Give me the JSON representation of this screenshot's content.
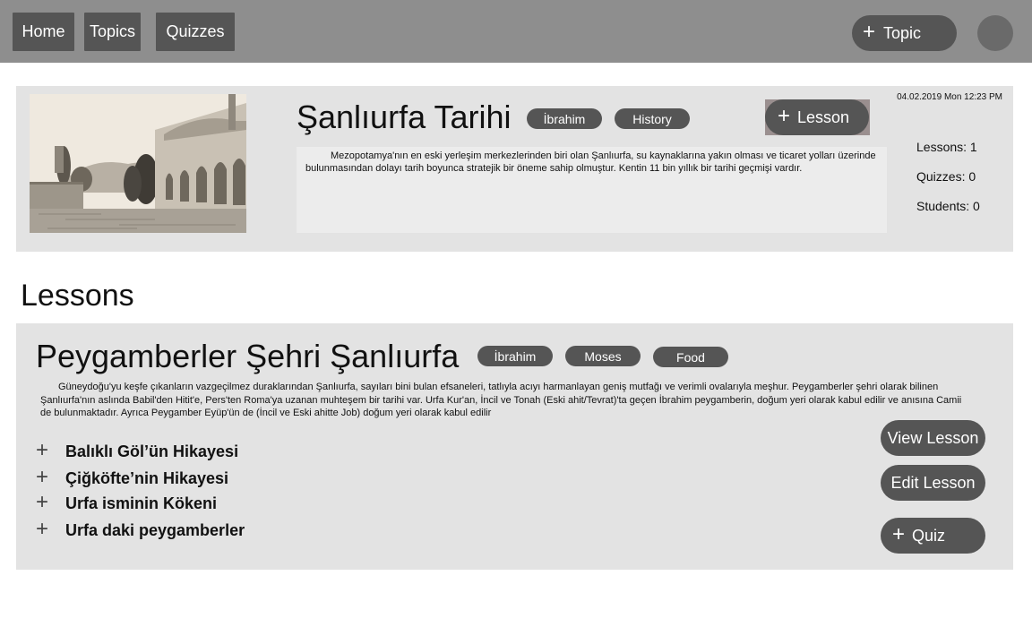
{
  "nav": {
    "home": "Home",
    "topics": "Topics",
    "quizzes": "Quizzes",
    "add_topic_icon": "plus-icon",
    "add_topic": "Topic"
  },
  "topic": {
    "title": "Şanlıurfa Tarihi",
    "tags": [
      "İbrahim",
      "History"
    ],
    "add_lesson": "Lesson",
    "datetime": "04.02.2019 Mon 12:23 PM",
    "description": "Mezopotamya'nın en eski yerleşim merkezlerinden biri olan Şanlıurfa, su kaynaklarına yakın olması ve ticaret yolları üzerinde bulunmasından dolayı tarih boyunca stratejik bir öneme sahip olmuştur. Kentin 11 bin yıllık bir tarihi geçmişi vardır.",
    "stats": {
      "lessons": "Lessons: 1",
      "quizzes": "Quizzes: 0",
      "students": "Students: 0"
    }
  },
  "lessons_heading": "Lessons",
  "lesson": {
    "title": "Peygamberler Şehri Şanlıurfa",
    "tags": [
      "İbrahim",
      "Moses",
      "Food"
    ],
    "description": "Güneydoğu'yu keşfe çıkanların vazgeçilmez duraklarından Şanlıurfa, sayıları bini bulan efsaneleri, tatlıyla acıyı harmanlayan geniş mutfağı ve verimli ovalarıyla meşhur. Peygamberler şehri olarak bilinen Şanlıurfa'nın aslında Babil'den Hitit'e, Pers'ten Roma'ya uzanan muhteşem bir tarihi var. Urfa Kur'an, İncil ve Tonah (Eski ahit/Tevrat)'ta geçen İbrahim peygamberin, doğum yeri olarak kabul edilir ve anısına Camii de bulunmaktadır. Ayrıca Peygamber Eyüp'ün de (İncil ve Eski ahitte Job) doğum yeri olarak kabul edilir",
    "sub_items": [
      "Balıklı Göl’ün Hikayesi",
      "Çiğköfte’nin Hikayesi",
      "Urfa isminin Kökeni",
      "Urfa daki peygamberler"
    ],
    "view_lesson": "View Lesson",
    "edit_lesson": "Edit Lesson",
    "add_quiz": "Quiz"
  }
}
